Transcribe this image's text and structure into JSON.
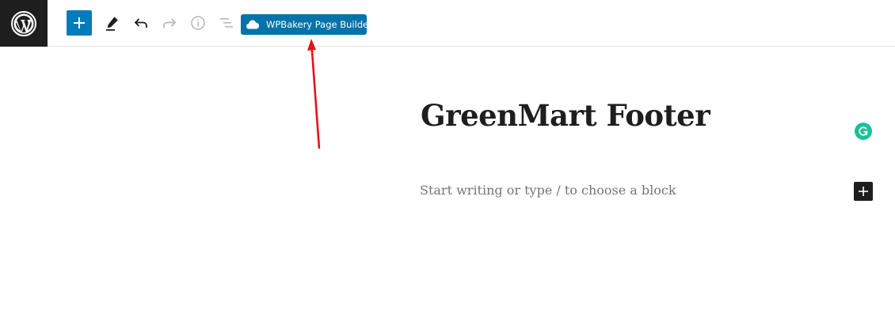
{
  "toolbar": {
    "logo_icon": "wordpress-logo-icon",
    "add_block_icon": "plus-icon",
    "tools_icon": "pencil-icon",
    "undo_icon": "undo-icon",
    "redo_icon": "redo-icon",
    "details_icon": "info-icon",
    "outline_icon": "list-view-icon",
    "wpbakery_label": "WPBakery Page Builder",
    "wpbakery_icon": "cloud-icon"
  },
  "editor": {
    "title": "GreenMart Footer",
    "block_placeholder": "Start writing or type / to choose a block",
    "grammarly_icon": "grammarly-icon",
    "inline_add_icon": "plus-icon"
  },
  "annotation": {
    "arrow_color": "#e8101a"
  },
  "colors": {
    "accent": "#007cba",
    "wpbakery": "#0473aa",
    "dark": "#1e1e1e",
    "grammarly": "#15c39a"
  }
}
